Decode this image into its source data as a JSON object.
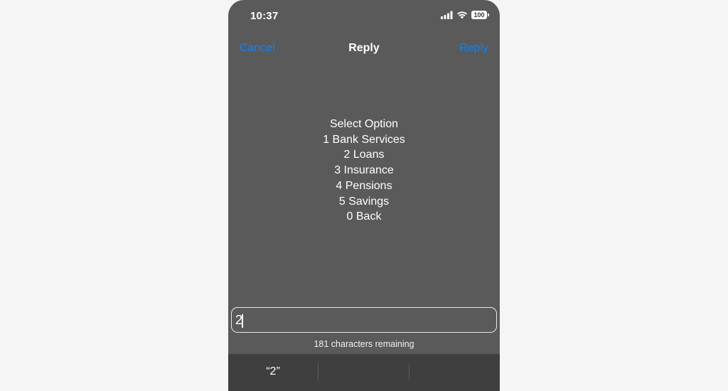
{
  "status_bar": {
    "time": "10:37",
    "battery_level": "100",
    "icons": [
      "cellular-signal-icon",
      "wifi-icon",
      "battery-icon"
    ]
  },
  "nav": {
    "cancel_label": "Cancel",
    "title": "Reply",
    "reply_label": "Reply",
    "accent_color": "#0a84ff"
  },
  "message": {
    "lines": [
      "Select Option",
      "1 Bank Services",
      "2 Loans",
      "3 Insurance",
      "4 Pensions",
      "5 Savings",
      "0 Back"
    ]
  },
  "input": {
    "value": "2"
  },
  "char_count": "181 characters remaining",
  "suggestions": [
    "“2”",
    "",
    ""
  ]
}
